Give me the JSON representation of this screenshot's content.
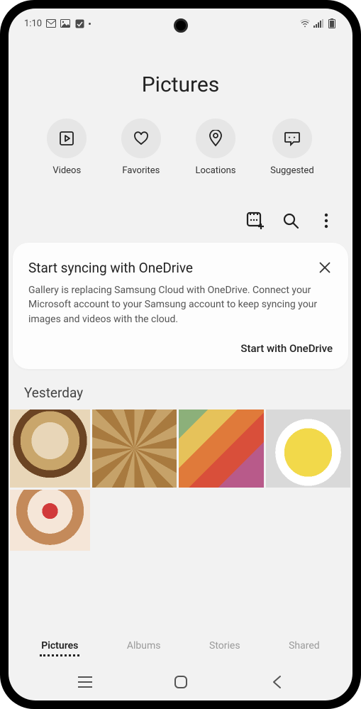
{
  "status": {
    "time": "1:10",
    "icons_left": [
      "mail-icon",
      "image-icon",
      "check-icon",
      "dot-icon"
    ],
    "icons_right": [
      "wifi-icon",
      "signal-icon",
      "battery-icon"
    ]
  },
  "page_title": "Pictures",
  "quick": [
    {
      "icon": "play-icon",
      "label": "Videos"
    },
    {
      "icon": "heart-icon",
      "label": "Favorites"
    },
    {
      "icon": "location-icon",
      "label": "Locations"
    },
    {
      "icon": "suggested-icon",
      "label": "Suggested"
    }
  ],
  "toolbar": {
    "create": "create-gif-icon",
    "search": "search-icon",
    "more": "more-icon"
  },
  "card": {
    "title": "Start syncing with OneDrive",
    "body": "Gallery is replacing Samsung Cloud with OneDrive. Connect your Microsoft account to your Samsung account to keep syncing your images and videos with the cloud.",
    "action": "Start with OneDrive"
  },
  "section": {
    "title": "Yesterday",
    "thumbs": [
      "food1",
      "food2",
      "food3",
      "food4",
      "food5"
    ]
  },
  "tabs": [
    {
      "label": "Pictures",
      "active": true
    },
    {
      "label": "Albums",
      "active": false
    },
    {
      "label": "Stories",
      "active": false
    },
    {
      "label": "Shared",
      "active": false
    }
  ],
  "nav": [
    "recents-icon",
    "home-icon",
    "back-icon"
  ]
}
